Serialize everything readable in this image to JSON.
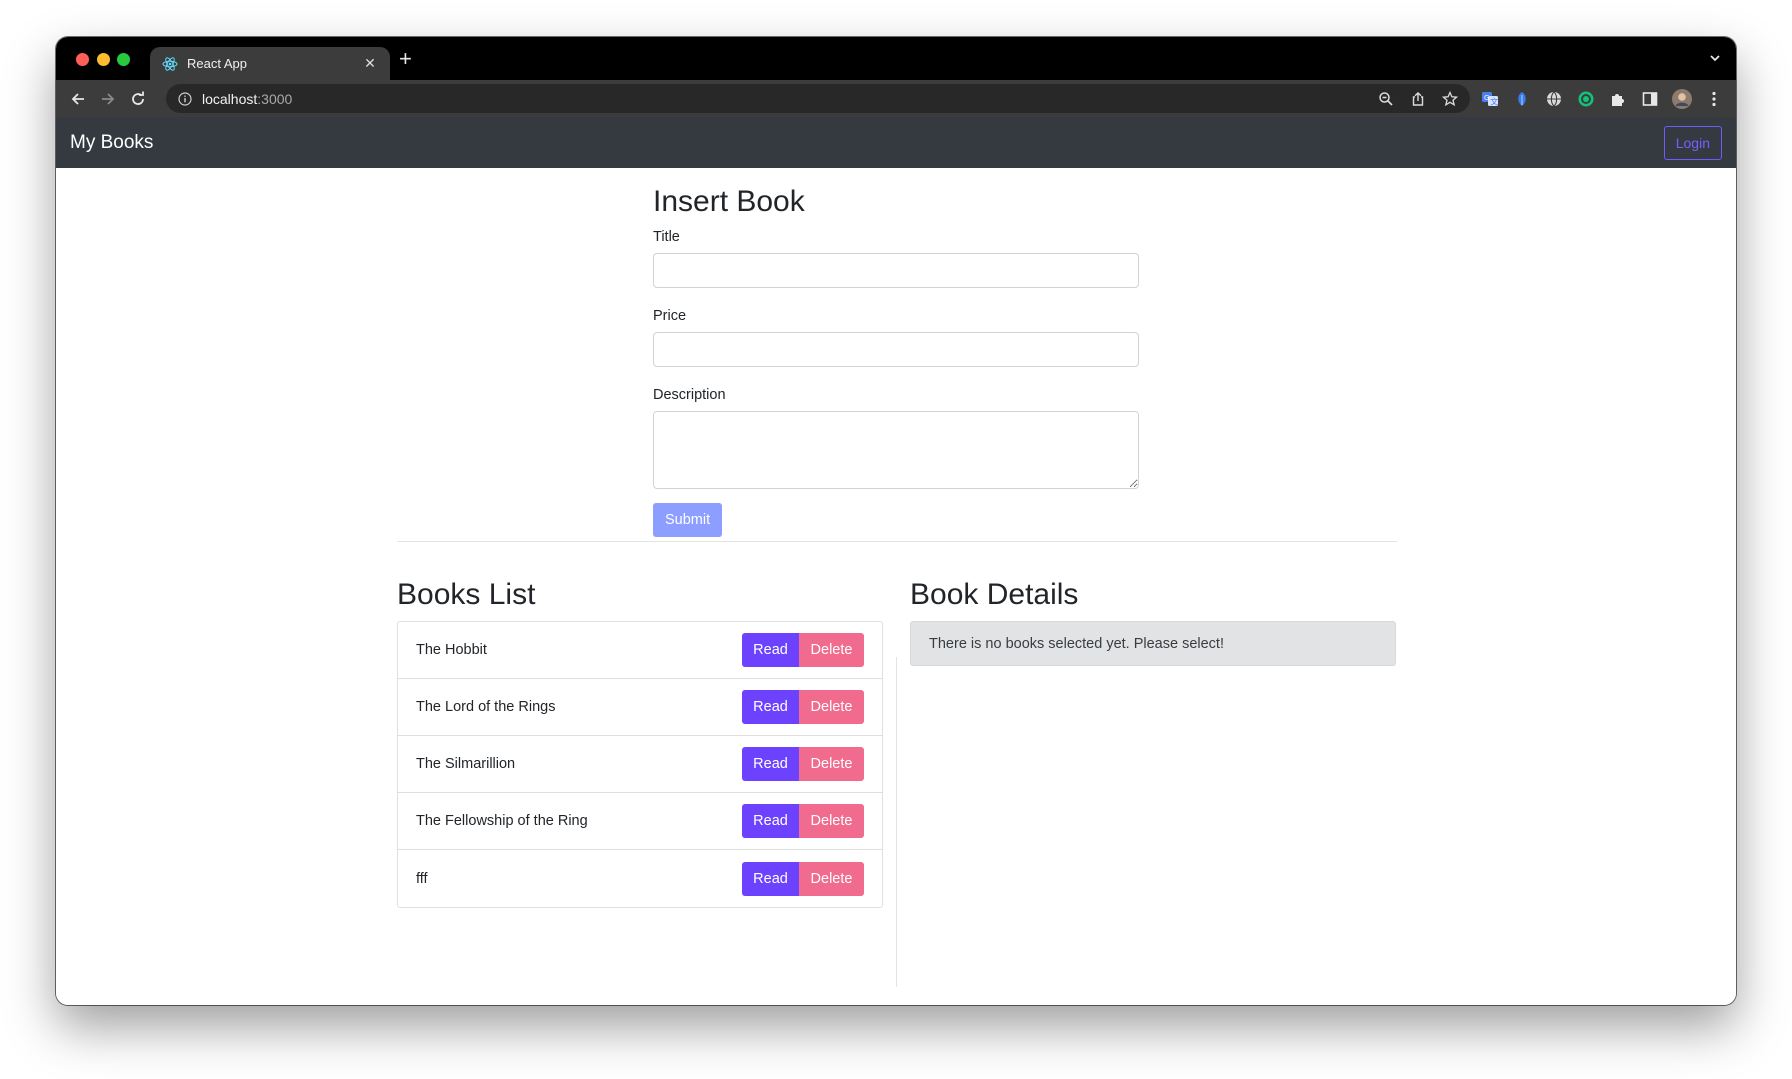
{
  "browser": {
    "tab_title": "React App",
    "url_host": "localhost",
    "url_port": ":3000"
  },
  "navbar": {
    "brand": "My Books",
    "login_label": "Login"
  },
  "insert_form": {
    "heading": "Insert Book",
    "title_label": "Title",
    "title_value": "",
    "price_label": "Price",
    "price_value": "",
    "description_label": "Description",
    "description_value": "",
    "submit_label": "Submit"
  },
  "books_list": {
    "heading": "Books List",
    "read_label": "Read",
    "delete_label": "Delete",
    "items": [
      {
        "title": "The Hobbit"
      },
      {
        "title": "The Lord of the Rings"
      },
      {
        "title": "The Silmarillion"
      },
      {
        "title": "The Fellowship of the Ring"
      },
      {
        "title": "fff"
      }
    ]
  },
  "book_details": {
    "heading": "Book Details",
    "empty_message": "There is no books selected yet. Please select!"
  },
  "colors": {
    "navbar_bg": "#343a40",
    "read_button": "#6c42ff",
    "delete_button": "#f06b8d",
    "submit_button": "#8c9eff",
    "login_outline": "#6a5cff"
  },
  "icons": [
    "react-icon",
    "close-icon",
    "plus-icon",
    "chevron-down-icon",
    "back-arrow-icon",
    "forward-arrow-icon",
    "reload-icon",
    "info-icon",
    "zoom-icon",
    "share-icon",
    "star-icon",
    "translate-icon",
    "leaf-icon",
    "globe-icon",
    "target-icon",
    "puzzle-icon",
    "sidebar-icon",
    "avatar",
    "kebab-menu-icon"
  ]
}
